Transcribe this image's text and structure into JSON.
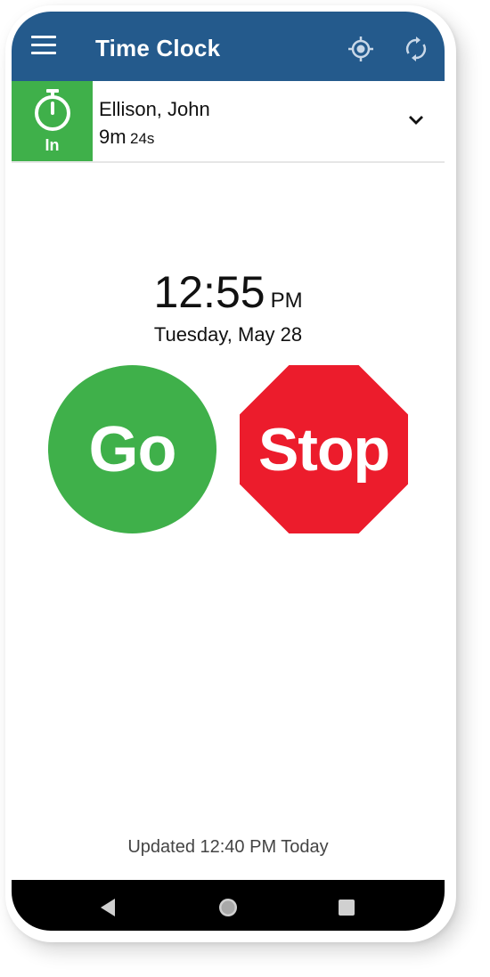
{
  "app_bar": {
    "title": "Time Clock",
    "icons": [
      "menu-icon",
      "locate-icon",
      "sync-icon"
    ],
    "color": "#245a8c"
  },
  "user_bar": {
    "status_label": "In",
    "status_color": "#3fb04a",
    "name": "Ellison, John",
    "elapsed_minutes": "9m",
    "elapsed_seconds": "24s",
    "icons": [
      "stopwatch-icon",
      "chevron-down-icon"
    ]
  },
  "clock": {
    "time": "12:55",
    "ampm": "PM",
    "date": "Tuesday, May 28"
  },
  "actions": {
    "go_label": "Go",
    "go_color": "#3fb04a",
    "stop_label": "Stop",
    "stop_color": "#ec1c2c"
  },
  "footer": {
    "updated_text": "Updated 12:40 PM Today"
  },
  "nav_bar": {
    "icons": [
      "back-icon",
      "home-icon",
      "recents-icon"
    ]
  }
}
